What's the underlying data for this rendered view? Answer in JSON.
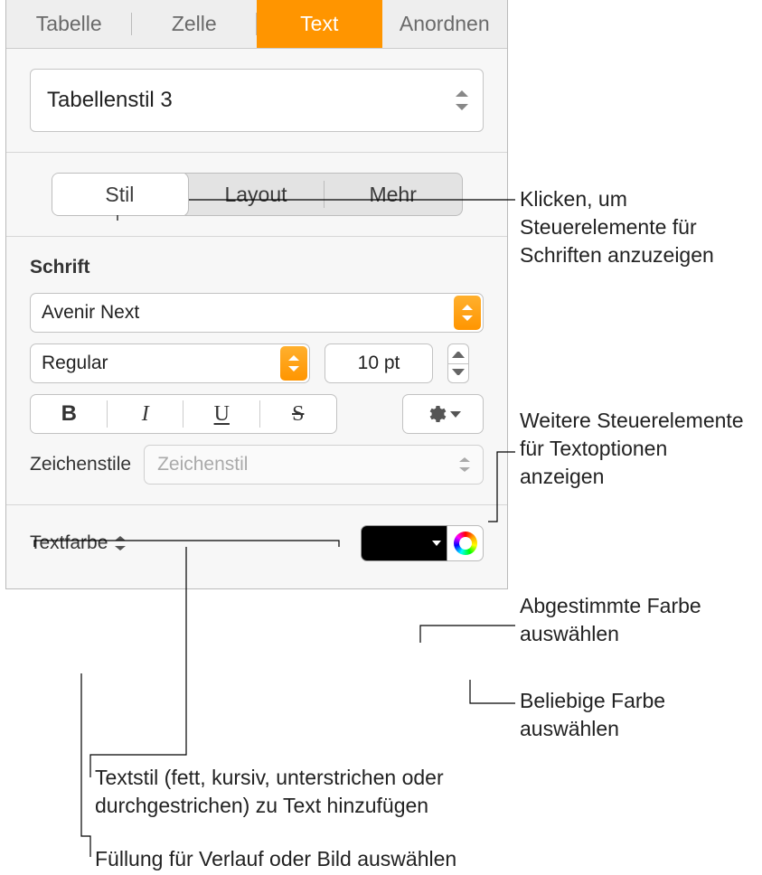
{
  "top_tabs": {
    "tabelle": "Tabelle",
    "zelle": "Zelle",
    "text": "Text",
    "anordnen": "Anordnen"
  },
  "style_preset": "Tabellenstil 3",
  "sub_tabs": {
    "stil": "Stil",
    "layout": "Layout",
    "mehr": "Mehr"
  },
  "font_section_label": "Schrift",
  "font_family": "Avenir Next",
  "font_weight": "Regular",
  "font_size": "10 pt",
  "char_styles_label": "Zeichenstile",
  "char_styles_placeholder": "Zeichenstil",
  "text_color_label": "Textfarbe",
  "text_color_value": "#000000",
  "callouts": {
    "stil_tab": "Klicken, um Steuerelemente für Schriften anzuzeigen",
    "gear": "Weitere Steuerelemente für Textoptionen anzeigen",
    "swatch": "Abgestimmte Farbe auswählen",
    "wheel": "Beliebige Farbe auswählen",
    "bius": "Textstil (fett, kursiv, unterstrichen oder durchgestrichen) zu Text hinzufügen",
    "textcolor": "Füllung für Verlauf oder Bild auswählen"
  }
}
